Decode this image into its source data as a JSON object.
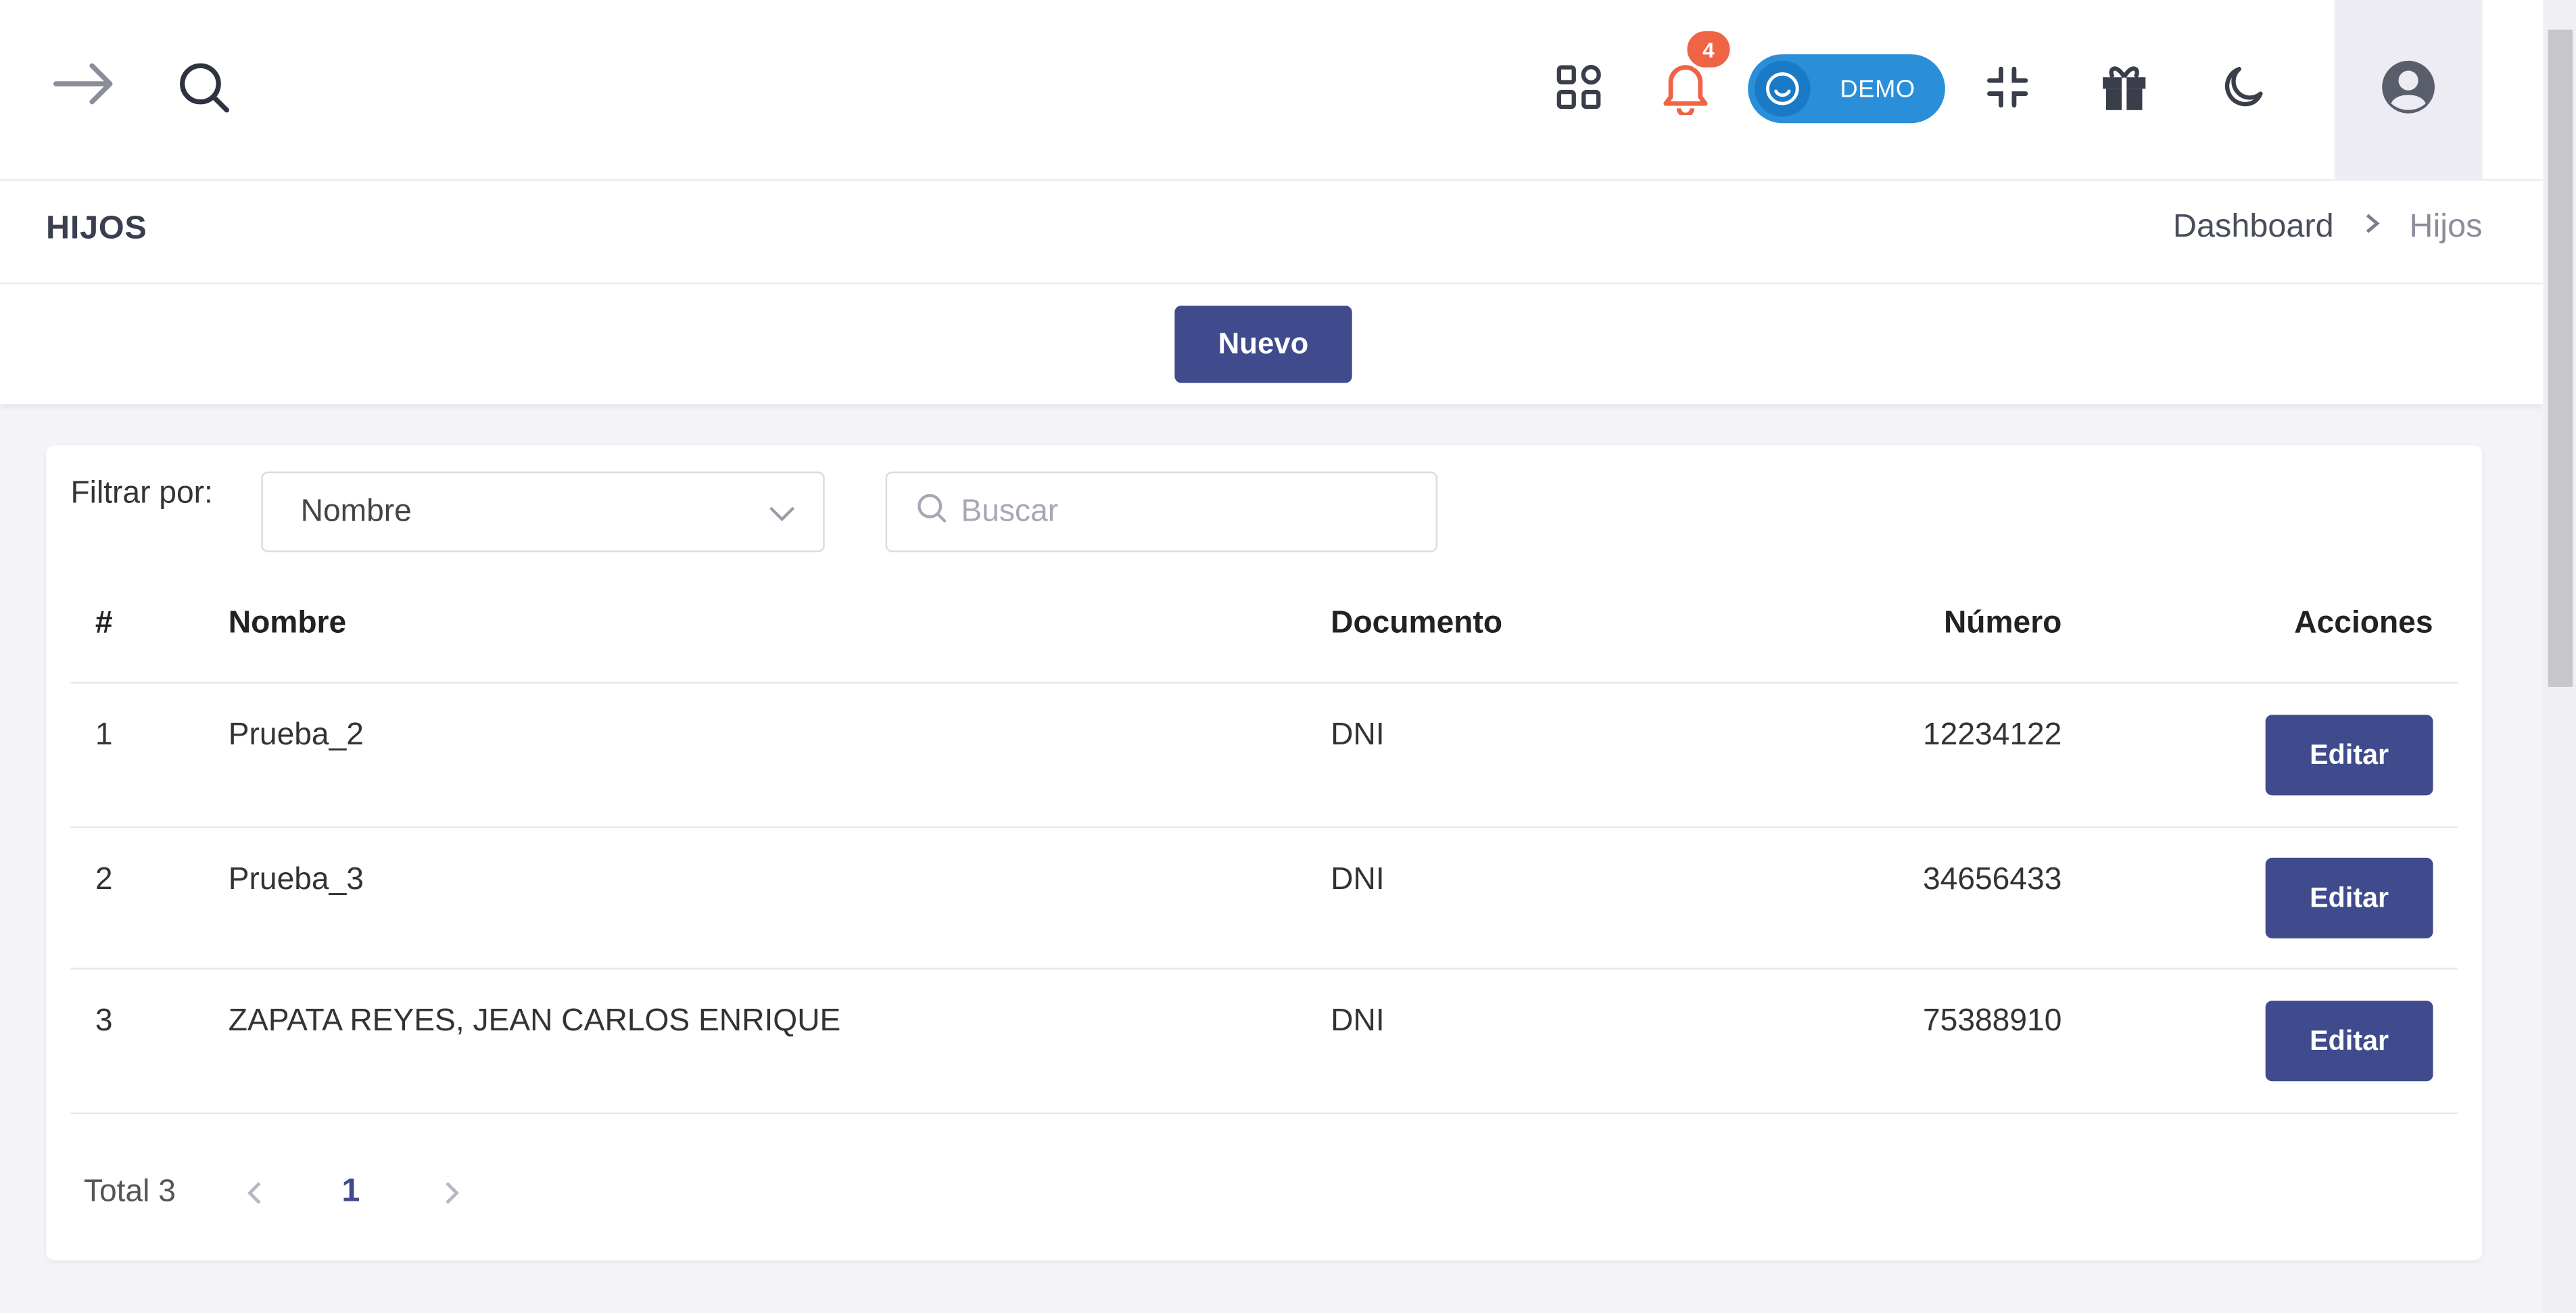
{
  "header": {
    "notification_count": "4",
    "demo_label": "DEMO"
  },
  "page": {
    "title": "HIJOS",
    "breadcrumb": [
      "Dashboard",
      "Hijos"
    ],
    "new_button": "Nuevo"
  },
  "filter": {
    "label": "Filtrar por:",
    "selected": "Nombre",
    "search_placeholder": "Buscar"
  },
  "table": {
    "headers": [
      "#",
      "Nombre",
      "Documento",
      "Número",
      "Acciones"
    ],
    "rows": [
      {
        "index": "1",
        "nombre": "Prueba_2",
        "documento": "DNI",
        "numero": "12234122",
        "action": "Editar"
      },
      {
        "index": "2",
        "nombre": "Prueba_3",
        "documento": "DNI",
        "numero": "34656433",
        "action": "Editar"
      },
      {
        "index": "3",
        "nombre": "ZAPATA REYES, JEAN CARLOS ENRIQUE",
        "documento": "DNI",
        "numero": "75388910",
        "action": "Editar"
      }
    ]
  },
  "pagination": {
    "total_label": "Total 3",
    "current_page": "1"
  },
  "colors": {
    "primary": "#3f4b8c",
    "notification": "#ee6444",
    "demo_toggle": "#2a8fd8",
    "background": "#f3f3f8"
  },
  "icons": [
    "arrow-right-icon",
    "search-icon",
    "apps-grid-icon",
    "bell-icon",
    "smile-icon",
    "compress-icon",
    "gift-icon",
    "moon-icon",
    "user-circle-icon",
    "chevron-down-icon",
    "chevron-left-icon",
    "chevron-right-icon"
  ]
}
